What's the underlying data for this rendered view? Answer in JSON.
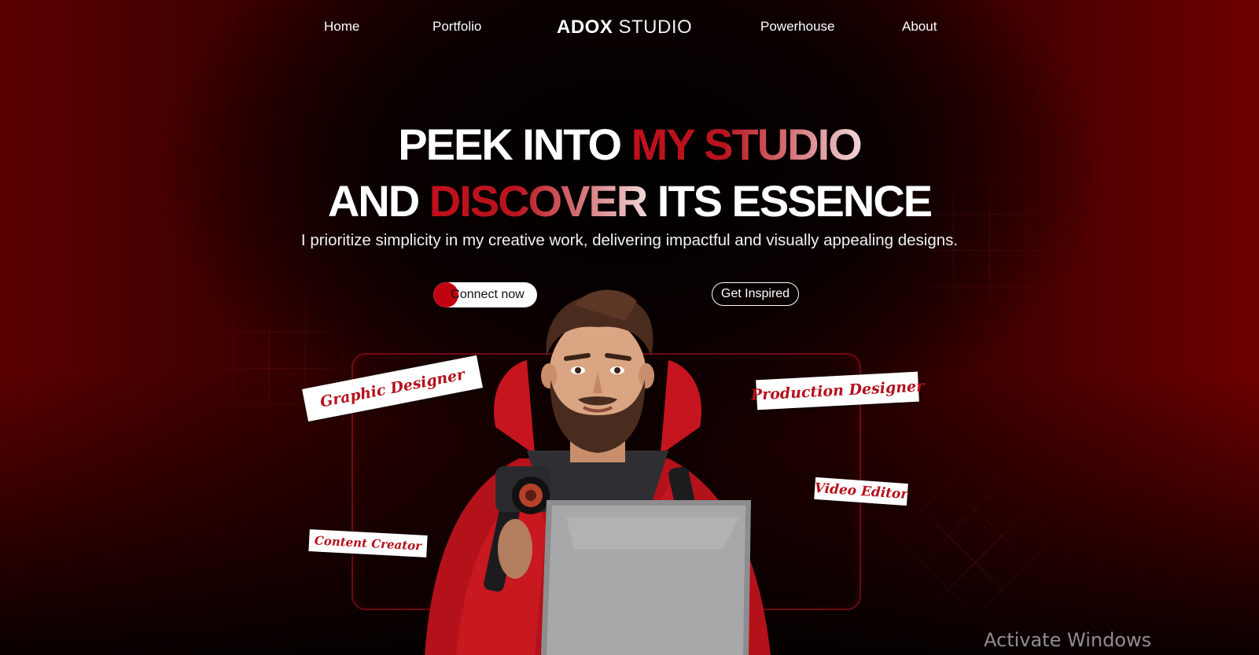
{
  "nav": {
    "home": "Home",
    "portfolio": "Portfolio",
    "brand_bold": "ADOX",
    "brand_light": "STUDIO",
    "powerhouse": "Powerhouse",
    "about": "About"
  },
  "hero": {
    "line1_a": "PEEK INTO ",
    "line1_accent": "MY STUDIO",
    "line2_a": "AND ",
    "line2_accent": "DISCOVER",
    "line2_b": " ITS ESSENCE",
    "subtitle": "I prioritize simplicity in my creative work, delivering impactful and visually appealing designs."
  },
  "buttons": {
    "connect": "Connect now",
    "inspired": "Get Inspired"
  },
  "tags": {
    "graphic": "Graphic Designer",
    "production": "Production Designer",
    "video": "Video Editor",
    "content": "Content Creator"
  },
  "watermark": "Activate Windows",
  "colors": {
    "accent_red": "#c0101b",
    "background_dark": "#0b0000",
    "background_red": "#6e0000",
    "tag_text": "#b3111c"
  },
  "icons": {
    "character": "bearded-man-with-camera-and-laptop-illustration"
  }
}
